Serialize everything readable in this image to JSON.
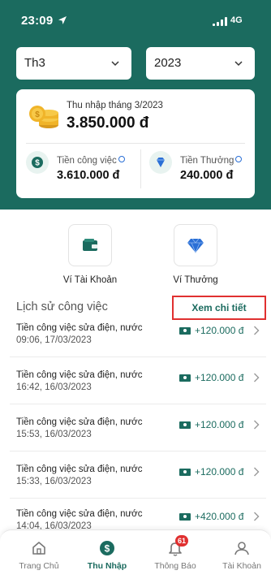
{
  "status_bar": {
    "time": "23:09",
    "network": "4G"
  },
  "filters": {
    "month": "Th3",
    "year": "2023"
  },
  "income": {
    "label": "Thu nhập tháng 3/2023",
    "total": "3.850.000 đ",
    "work_label": "Tiền công việc",
    "work_value": "3.610.000 đ",
    "bonus_label": "Tiền Thưởng",
    "bonus_value": "240.000 đ"
  },
  "wallets": {
    "account_label": "Ví Tài Khoản",
    "bonus_label": "Ví Thưởng"
  },
  "history": {
    "title": "Lịch sử công việc",
    "view_details": "Xem chi tiết",
    "items": [
      {
        "title": "Tiền công việc sửa điện, nước",
        "datetime": "09:06, 17/03/2023",
        "amount": "+120.000 đ"
      },
      {
        "title": "Tiền công việc sửa điện, nước",
        "datetime": "16:42, 16/03/2023",
        "amount": "+120.000 đ"
      },
      {
        "title": "Tiền công việc sửa điện, nước",
        "datetime": "15:53, 16/03/2023",
        "amount": "+120.000 đ"
      },
      {
        "title": "Tiền công việc sửa điện, nước",
        "datetime": "15:33, 16/03/2023",
        "amount": "+120.000 đ"
      },
      {
        "title": "Tiền công việc sửa điện, nước",
        "datetime": "14:04, 16/03/2023",
        "amount": "+420.000 đ"
      }
    ]
  },
  "tabbar": {
    "items": [
      {
        "label": "Trang Chủ",
        "icon": "home-icon"
      },
      {
        "label": "Thu Nhập",
        "icon": "dollar-icon"
      },
      {
        "label": "Thông Báo",
        "icon": "bell-icon",
        "badge": "61"
      },
      {
        "label": "Tài Khoản",
        "icon": "user-icon"
      }
    ]
  },
  "colors": {
    "primary": "#1b6b5f",
    "highlight_border": "#e03030",
    "badge": "#e03030"
  }
}
